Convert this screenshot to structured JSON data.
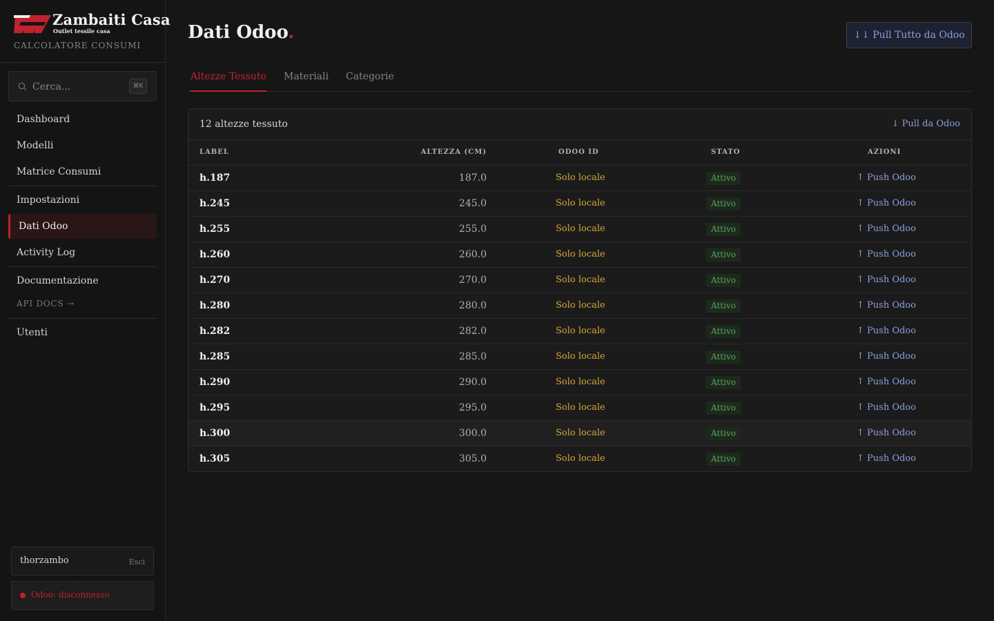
{
  "brand": {
    "name": "Zambaiti Casa",
    "tagline": "Outlet tessile casa",
    "subtitle": "CALCOLATORE CONSUMI",
    "logo_color": "#c1222e"
  },
  "search": {
    "placeholder": "Cerca...",
    "shortcut": "⌘K"
  },
  "sidebar": {
    "items": [
      {
        "label": "Dashboard"
      },
      {
        "label": "Modelli"
      },
      {
        "label": "Matrice Consumi"
      },
      {
        "label": "Impostazioni"
      },
      {
        "label": "Dati Odoo",
        "active": true
      },
      {
        "label": "Activity Log"
      },
      {
        "label": "Documentazione"
      },
      {
        "label": "Utenti"
      }
    ],
    "api_docs": "API DOCS →"
  },
  "user": {
    "name": "thorzambo",
    "logout": "Esci"
  },
  "odoo_status": {
    "text": "Odoo: disconnesso",
    "color": "#c1222e"
  },
  "header": {
    "title": "Dati Odoo",
    "title_dot": ".",
    "pull_all": "↓↓ Pull Tutto da Odoo"
  },
  "tabs": [
    {
      "label": "Altezze Tessuto",
      "active": true
    },
    {
      "label": "Materiali"
    },
    {
      "label": "Categorie"
    }
  ],
  "table": {
    "count_label": "12 altezze tessuto",
    "pull_label": "↓ Pull da Odoo",
    "columns": [
      "LABEL",
      "ALTEZZA (CM)",
      "ODOO ID",
      "STATO",
      "AZIONI"
    ],
    "rows": [
      {
        "label": "h.187",
        "altezza": "187.0",
        "odoo_id": "Solo locale",
        "stato": "Attivo",
        "azione": "↑ Push Odoo"
      },
      {
        "label": "h.245",
        "altezza": "245.0",
        "odoo_id": "Solo locale",
        "stato": "Attivo",
        "azione": "↑ Push Odoo"
      },
      {
        "label": "h.255",
        "altezza": "255.0",
        "odoo_id": "Solo locale",
        "stato": "Attivo",
        "azione": "↑ Push Odoo"
      },
      {
        "label": "h.260",
        "altezza": "260.0",
        "odoo_id": "Solo locale",
        "stato": "Attivo",
        "azione": "↑ Push Odoo"
      },
      {
        "label": "h.270",
        "altezza": "270.0",
        "odoo_id": "Solo locale",
        "stato": "Attivo",
        "azione": "↑ Push Odoo"
      },
      {
        "label": "h.280",
        "altezza": "280.0",
        "odoo_id": "Solo locale",
        "stato": "Attivo",
        "azione": "↑ Push Odoo"
      },
      {
        "label": "h.282",
        "altezza": "282.0",
        "odoo_id": "Solo locale",
        "stato": "Attivo",
        "azione": "↑ Push Odoo"
      },
      {
        "label": "h.285",
        "altezza": "285.0",
        "odoo_id": "Solo locale",
        "stato": "Attivo",
        "azione": "↑ Push Odoo"
      },
      {
        "label": "h.290",
        "altezza": "290.0",
        "odoo_id": "Solo locale",
        "stato": "Attivo",
        "azione": "↑ Push Odoo"
      },
      {
        "label": "h.295",
        "altezza": "295.0",
        "odoo_id": "Solo locale",
        "stato": "Attivo",
        "azione": "↑ Push Odoo"
      },
      {
        "label": "h.300",
        "altezza": "300.0",
        "odoo_id": "Solo locale",
        "stato": "Attivo",
        "azione": "↑ Push Odoo"
      },
      {
        "label": "h.305",
        "altezza": "305.0",
        "odoo_id": "Solo locale",
        "stato": "Attivo",
        "azione": "↑ Push Odoo"
      }
    ]
  },
  "colors": {
    "accent": "#c1222e",
    "link": "#8f9ee0",
    "warning": "#d9a63a",
    "success": "#5fa05f"
  }
}
